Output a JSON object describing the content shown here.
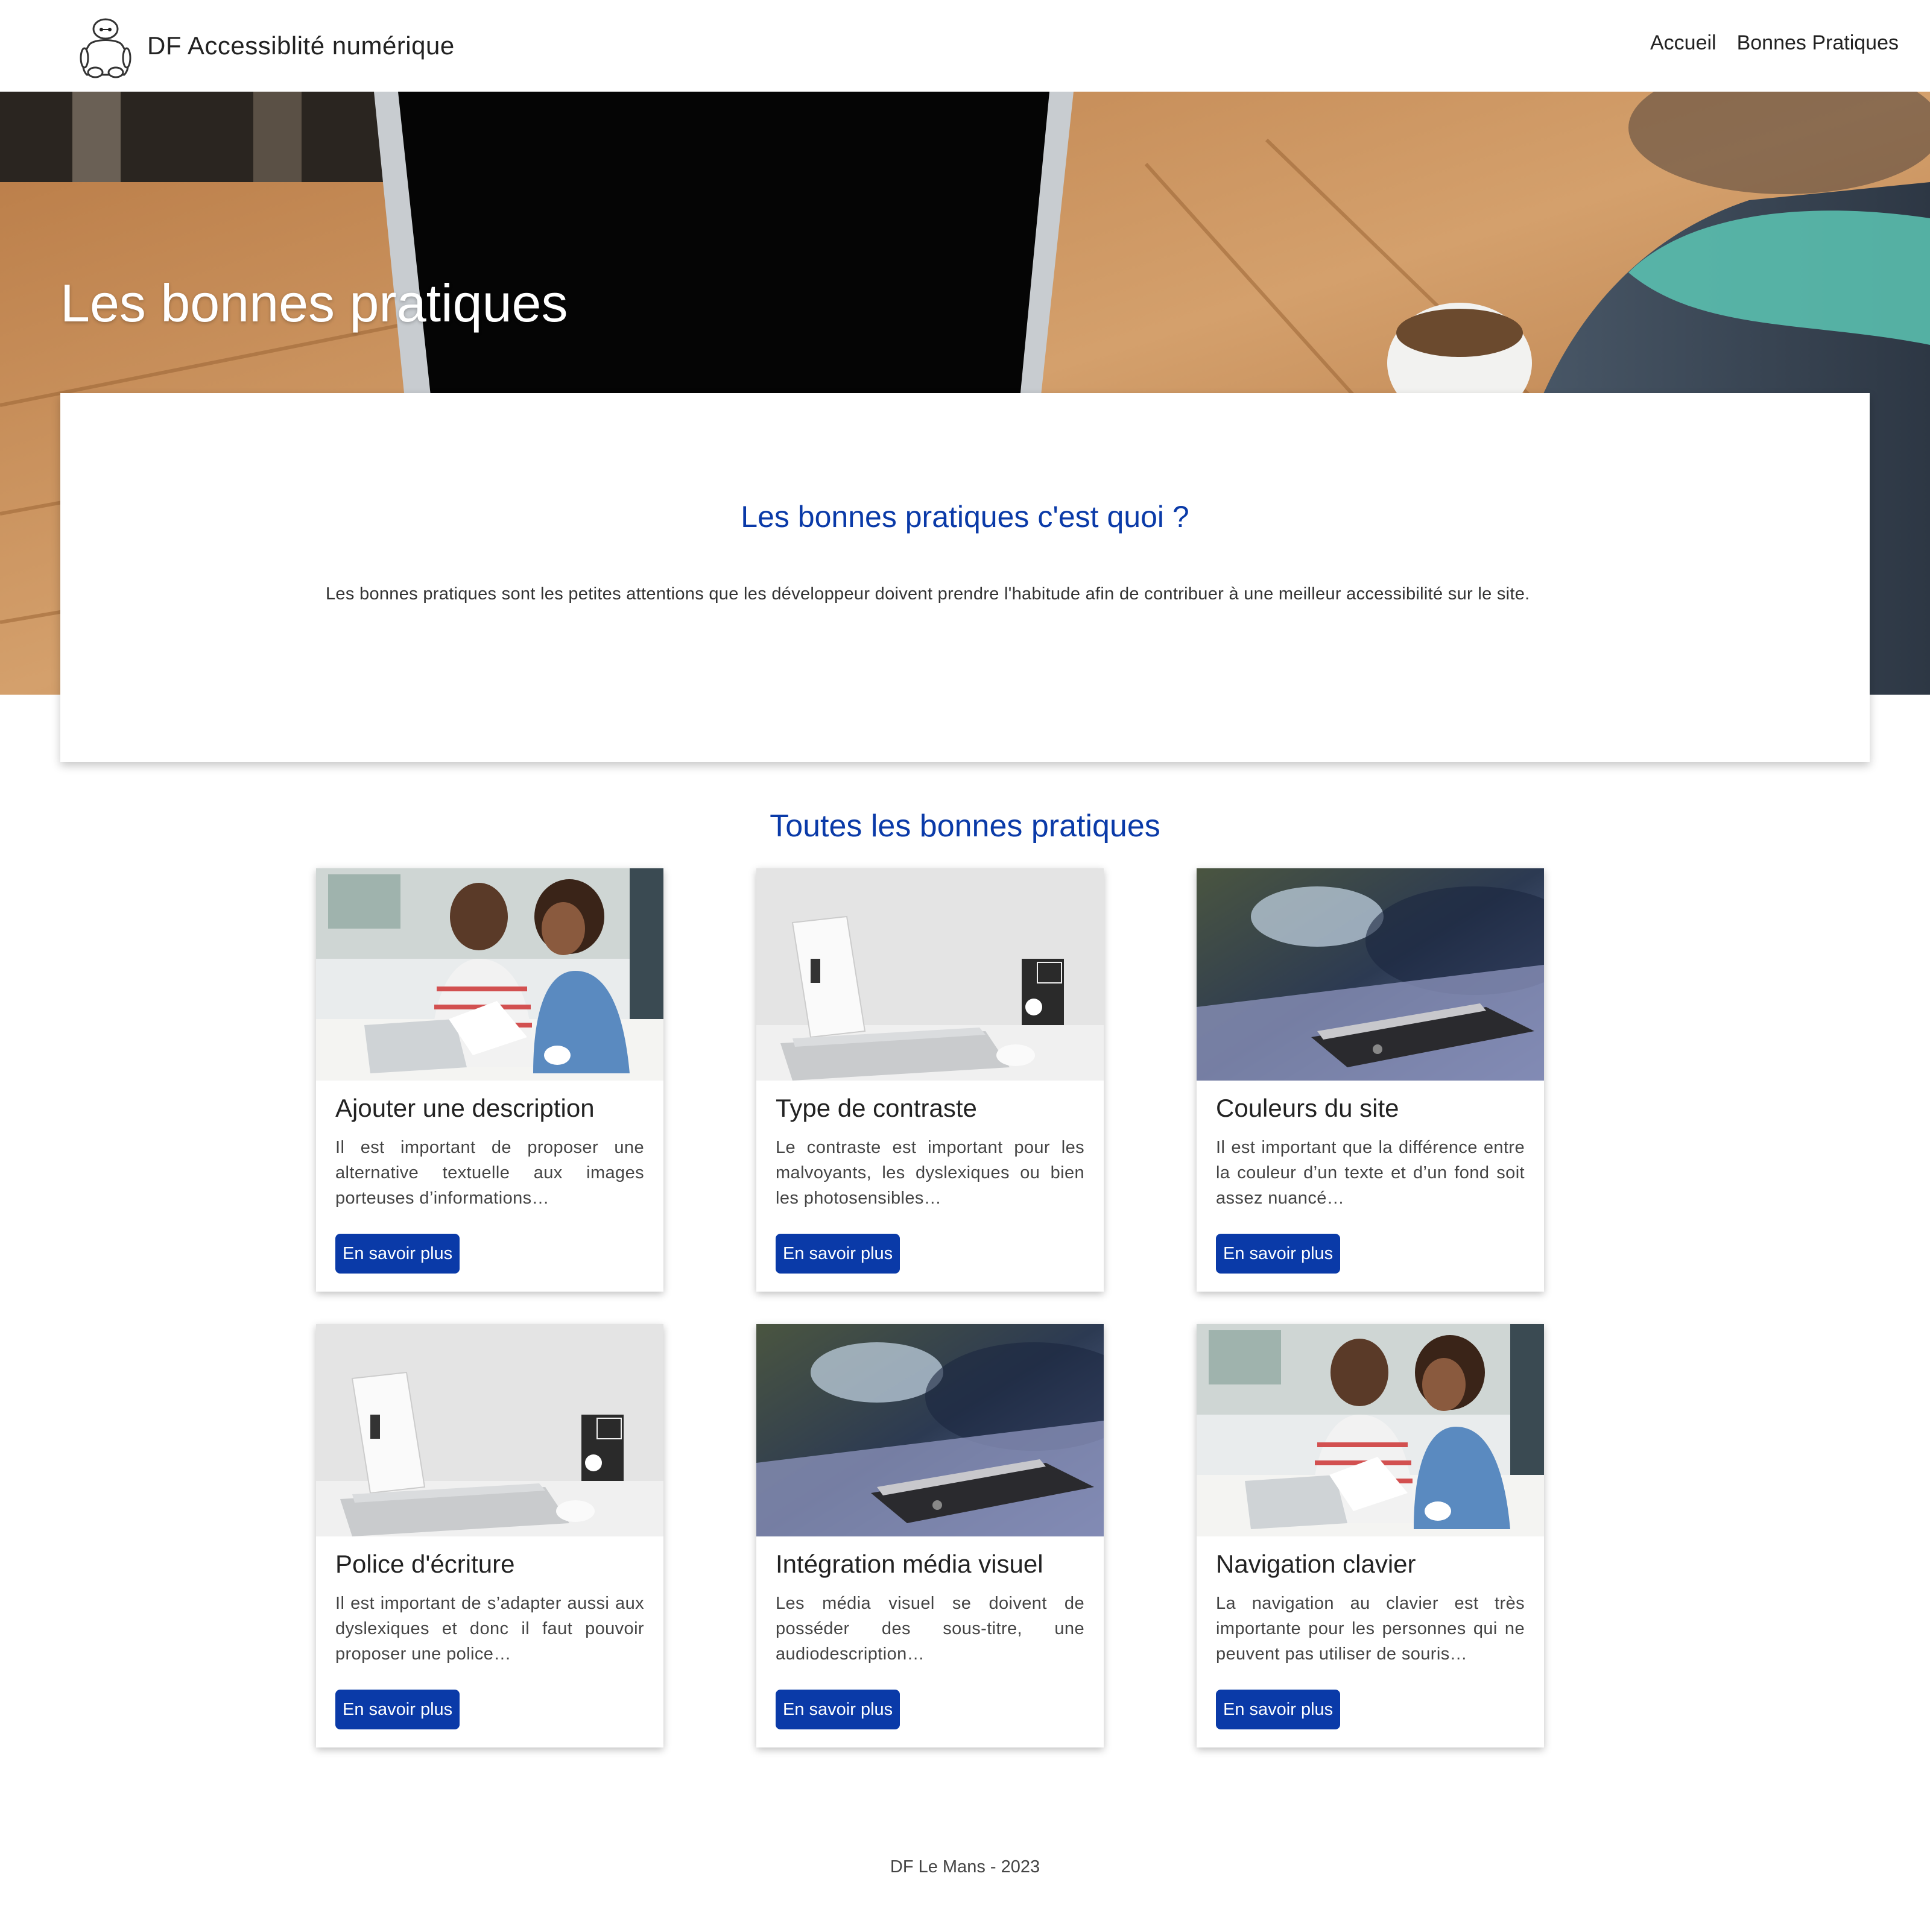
{
  "header": {
    "brand_name": "DF Accessiblité numérique",
    "logo_icon": "robot-mascot-icon",
    "nav": [
      {
        "label": "Accueil"
      },
      {
        "label": "Bonnes Pratiques"
      }
    ]
  },
  "hero": {
    "title": "Les bonnes pratiques",
    "background_image": "laptop-on-wooden-desk-photo"
  },
  "intro": {
    "title": "Les bonnes pratiques c'est quoi ?",
    "text": "Les bonnes pratiques sont les petites attentions que les développeur doivent prendre l'habitude afin de contribuer à une meilleur accessibilité sur le site."
  },
  "section": {
    "title": "Toutes les bonnes pratiques"
  },
  "cards": [
    {
      "title": "Ajouter une description",
      "text": "Il est important de proposer une alternative textuelle aux images porteuses d’informations…",
      "button": "En savoir plus",
      "image": "couple-laptop-photo"
    },
    {
      "title": "Type de contraste",
      "text": "Le contraste est important pour les malvoyants, les dyslexiques ou bien les photosensibles…",
      "button": "En savoir plus",
      "image": "laptop-books-photo"
    },
    {
      "title": "Couleurs du site",
      "text": "Il est important que la différence entre la couleur d’un texte et d’un fond soit assez nuancé…",
      "button": "En savoir plus",
      "image": "smartphone-photo"
    },
    {
      "title": "Police d'écriture",
      "text": "Il est important de s’adapter aussi aux dyslexiques et donc il faut pouvoir proposer une police…",
      "button": "En savoir plus",
      "image": "laptop-books-photo"
    },
    {
      "title": "Intégration média visuel",
      "text": "Les média visuel se doivent de posséder des sous-titre, une audiodescription…",
      "button": "En savoir plus",
      "image": "smartphone-photo"
    },
    {
      "title": "Navigation clavier",
      "text": "La navigation au clavier est très importante pour les personnes qui ne peuvent pas utiliser de souris…",
      "button": "En savoir plus",
      "image": "couple-laptop-photo"
    }
  ],
  "footer": {
    "text": "DF Le Mans - 2023"
  },
  "colors": {
    "accent": "#0a3aa8",
    "button_bg": "#0a3aa8",
    "button_text": "#ffffff",
    "heading_dark": "#222222"
  }
}
